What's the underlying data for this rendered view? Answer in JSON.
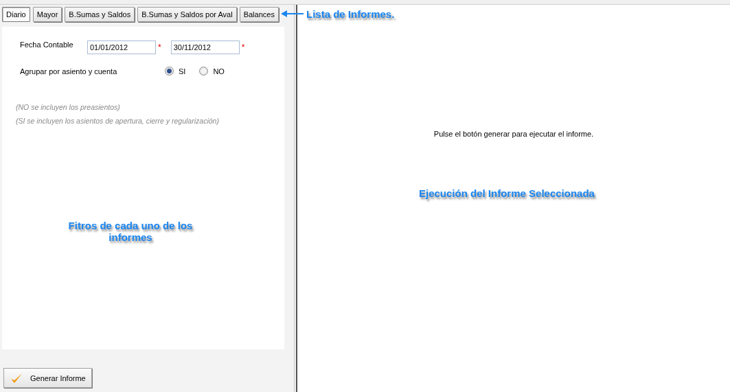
{
  "tabs": [
    {
      "label": "Diario",
      "selected": true
    },
    {
      "label": "Mayor",
      "selected": false
    },
    {
      "label": "B.Sumas y Saldos",
      "selected": false
    },
    {
      "label": "B.Sumas y Saldos por Aval",
      "selected": false
    },
    {
      "label": "Balances",
      "selected": false
    }
  ],
  "filters": {
    "date_label": "Fecha Contable",
    "date_from": "01/01/2012",
    "date_to": "30/11/2012",
    "required_mark": "*",
    "group_label": "Agrupar por asiento y cuenta",
    "group_options": [
      {
        "label": "SI",
        "selected": true
      },
      {
        "label": "NO",
        "selected": false
      }
    ],
    "notes": [
      "(NO se incluyen los preasientos)",
      "(SI se incluyen los asientos de apertura, cierre y regularización)"
    ]
  },
  "generate_button": "Generar Informe",
  "report": {
    "message": "Pulse el botón generar para ejecutar el informe."
  },
  "annotations": {
    "tabs": "Lista de Informes.",
    "filters": "Fitros de cada uno de los informes",
    "report": "Ejecución del Informe Seleccionada"
  }
}
